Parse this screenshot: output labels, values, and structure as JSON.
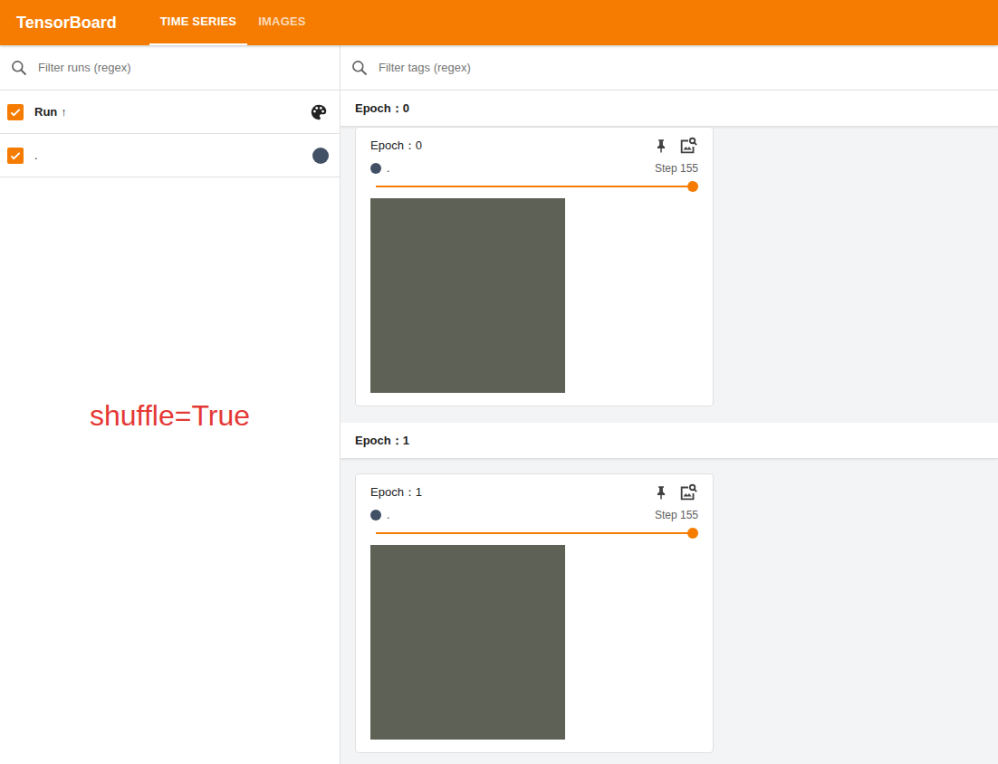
{
  "app": {
    "title": "TensorBoard"
  },
  "tabs": [
    {
      "label": "TIME SERIES",
      "selected": true
    },
    {
      "label": "IMAGES",
      "selected": false
    }
  ],
  "runs_panel": {
    "search": {
      "placeholder": "Filter runs (regex)"
    },
    "header": {
      "label": "Run",
      "sort_icon": "↑",
      "checked": true
    },
    "runs": [
      {
        "name": ".",
        "checked": true,
        "color": "#425066"
      }
    ]
  },
  "annotation": "shuffle=True",
  "tags_search": {
    "placeholder": "Filter tags (regex)"
  },
  "groups": [
    {
      "title": "Epoch：0",
      "cards": [
        {
          "title": "Epoch：0",
          "run": ".",
          "run_color": "#425066",
          "step": "Step 155",
          "level": 1
        }
      ]
    },
    {
      "title": "Epoch：1",
      "cards": [
        {
          "title": "Epoch：1",
          "run": ".",
          "run_color": "#425066",
          "step": "Step 155",
          "level": 1
        }
      ]
    }
  ]
}
